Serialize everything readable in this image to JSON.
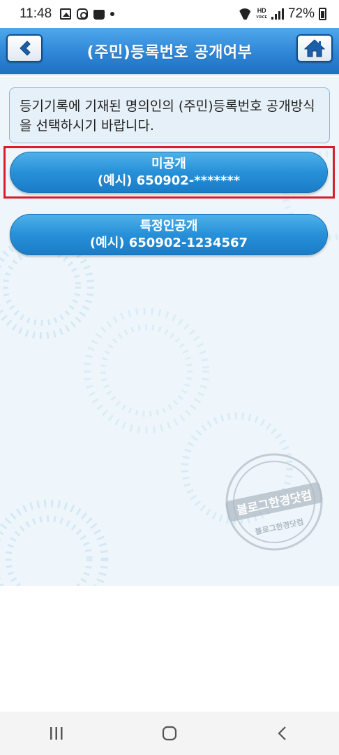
{
  "status_bar": {
    "time": "11:48",
    "battery": "72%",
    "hd_label": "HD",
    "voice_label": "VOICE"
  },
  "header": {
    "title": "(주민)등록번호 공개여부",
    "back_icon": "chevron-left-icon",
    "home_icon": "home-icon"
  },
  "info": {
    "text_line1": "등기기록에 기재된 명의인의 (주민)등록번호 공개방식",
    "text_line2": "을 선택하시기 바랍니다."
  },
  "options": [
    {
      "label": "미공개",
      "example": "(예시) 650902-*******"
    },
    {
      "label": "특정인공개",
      "example": "(예시) 650902-1234567"
    }
  ],
  "watermark": {
    "main_text": "블로그한경닷컴",
    "sub_text": "블로그한경닷컴"
  },
  "colors": {
    "header_blue": "#2f86d6",
    "button_blue": "#2790d8",
    "highlight_red": "#d81e2c"
  }
}
